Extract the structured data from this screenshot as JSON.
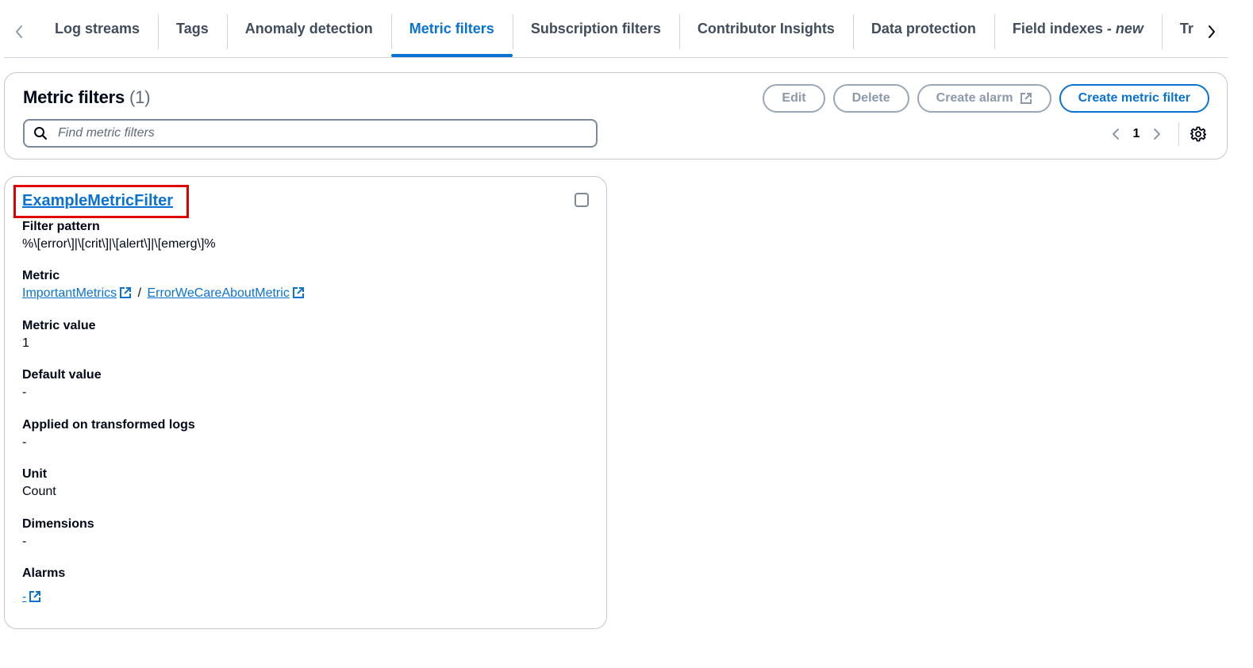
{
  "tabs": {
    "items": [
      {
        "label": "Log streams"
      },
      {
        "label": "Tags"
      },
      {
        "label": "Anomaly detection"
      },
      {
        "label": "Metric filters",
        "active": true
      },
      {
        "label": "Subscription filters"
      },
      {
        "label": "Contributor Insights"
      },
      {
        "label": "Data protection"
      },
      {
        "label": "Field indexes",
        "suffix": " - ",
        "badge": "new"
      },
      {
        "label": "Transformer"
      }
    ]
  },
  "header": {
    "title": "Metric filters",
    "count": "(1)",
    "search_placeholder": "Find metric filters",
    "buttons": {
      "edit": "Edit",
      "delete": "Delete",
      "create_alarm": "Create alarm",
      "create_metric_filter": "Create metric filter"
    },
    "pagination": {
      "current_page": "1"
    }
  },
  "card": {
    "name": "ExampleMetricFilter",
    "filter_pattern": {
      "label": "Filter pattern",
      "value": "%\\[error\\]|\\[crit\\]|\\[alert\\]|\\[emerg\\]%"
    },
    "metric": {
      "label": "Metric",
      "namespace": "ImportantMetrics",
      "separator": "/",
      "name": "ErrorWeCareAboutMetric"
    },
    "metric_value": {
      "label": "Metric value",
      "value": "1"
    },
    "default_value": {
      "label": "Default value",
      "value": "-"
    },
    "applied_on_transformed_logs": {
      "label": "Applied on transformed logs",
      "value": "-"
    },
    "unit": {
      "label": "Unit",
      "value": "Count"
    },
    "dimensions": {
      "label": "Dimensions",
      "value": "-"
    },
    "alarms": {
      "label": "Alarms",
      "value": "-"
    }
  },
  "colors": {
    "accent": "#0972d3",
    "highlight_box": "#e00000",
    "text": "#000716",
    "disabled": "#8d99a8"
  }
}
